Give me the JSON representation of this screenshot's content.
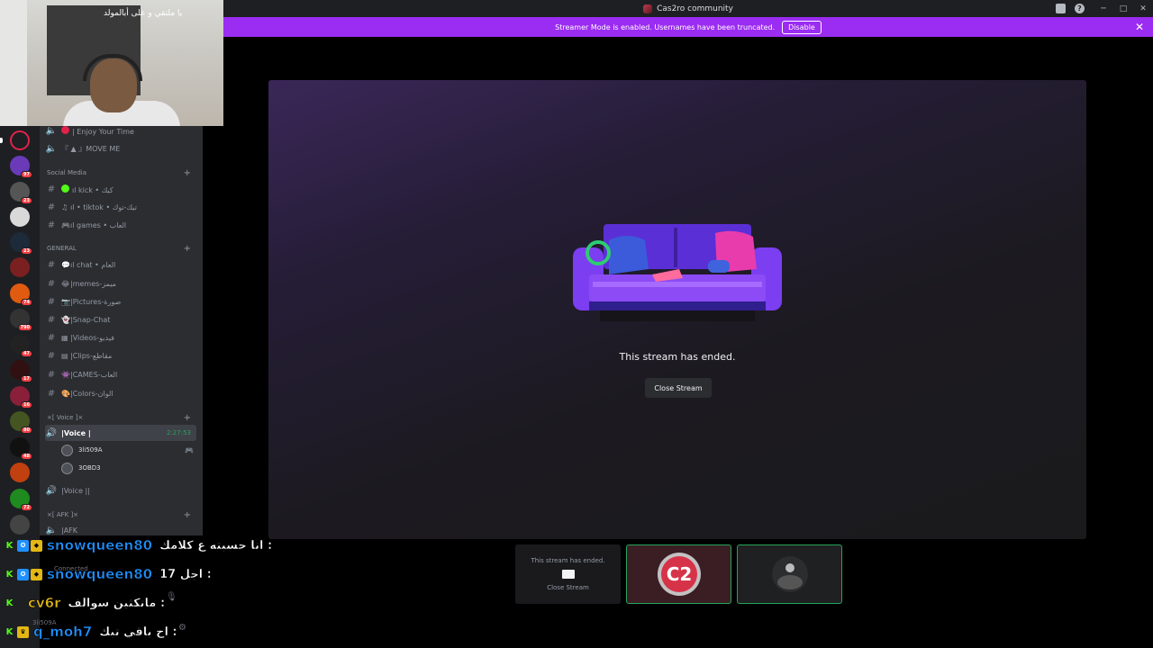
{
  "window": {
    "title": "Cas2ro community",
    "controls": {
      "minimize": "─",
      "maximize": "□",
      "close": "✕"
    },
    "help": "?"
  },
  "banner": {
    "text": "Streamer Mode is enabled. Usernames have been truncated.",
    "disable_label": "Disable",
    "close": "✕",
    "color": "#9b2cf2"
  },
  "webcam": {
    "flag_text": "يا ملتقي و على أبالمولد"
  },
  "servers": [
    {
      "badge": ""
    },
    {
      "badge": "97"
    },
    {
      "badge": "23"
    },
    {
      "badge": ""
    },
    {
      "badge": "23"
    },
    {
      "badge": ""
    },
    {
      "badge": "74"
    },
    {
      "badge": "790"
    },
    {
      "badge": "47"
    },
    {
      "badge": "17"
    },
    {
      "badge": "16"
    },
    {
      "badge": "80"
    },
    {
      "badge": "48"
    },
    {
      "badge": ""
    },
    {
      "badge": "72"
    },
    {
      "badge": ""
    }
  ],
  "sidebar": {
    "top_channels": [
      {
        "label": "| Enjoy Your Time"
      },
      {
        "label": "『 ▲ 』MOVE ME"
      }
    ],
    "categories": {
      "social": "Social Media",
      "general": "GENERAL",
      "voice": "×[ Voice ]×",
      "afk": "×[ AFK ]×"
    },
    "social_channels": [
      {
        "label": "ıl kick • كيك"
      },
      {
        "label": "ıl  • tiktok • تيك-توك"
      },
      {
        "label": "ıl games • العاب"
      }
    ],
    "general_channels": [
      {
        "label": "ıl chat • العام"
      },
      {
        "label": "|memes-ميمز"
      },
      {
        "label": "|Pictures-صورة"
      },
      {
        "label": "|Snap-Chat"
      },
      {
        "label": "|Videos-فيديو"
      },
      {
        "label": "|Clips-مقاطع"
      },
      {
        "label": "|CAMES-العاب"
      },
      {
        "label": "|Colors-الوان"
      }
    ],
    "voice_channels": [
      {
        "label": "|Voice |",
        "time": "2:27:53"
      },
      {
        "label": "|Voice ||"
      }
    ],
    "voice_users": [
      {
        "name": "3li509A"
      },
      {
        "name": "3OBD3"
      }
    ],
    "afk_channel": "|AFK",
    "faded_connected": "Connected",
    "faded_user": "3li509A"
  },
  "stream": {
    "ended_text": "This stream has ended.",
    "close_label": "Close Stream"
  },
  "strip": {
    "tile1_text": "This stream has ended.",
    "tile1_close": "Close Stream",
    "tile2_logo": "C2"
  },
  "chat": [
    {
      "icons": [
        "K",
        "B",
        "C"
      ],
      "user": "snowqueen80",
      "user_color": "#1e90ff",
      "msg": "انا حسبته ع كلامك :"
    },
    {
      "icons": [
        "K",
        "B",
        "C"
      ],
      "user": "snowqueen80",
      "user_color": "#1e90ff",
      "msg": "اجل 17 :"
    },
    {
      "icons": [
        "K"
      ],
      "user": "cv6r",
      "user_color": "#e2b714",
      "msg": "ماتكثين سوالف :"
    },
    {
      "icons": [
        "K",
        "C"
      ],
      "user": "q_moh7",
      "user_color": "#1e90ff",
      "msg": "اح باقي تبك :"
    }
  ]
}
